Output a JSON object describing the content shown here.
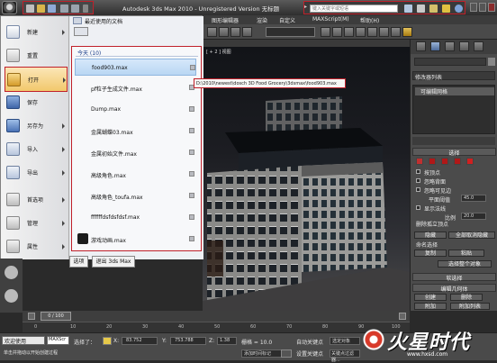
{
  "title_bar": {
    "title": "Autodesk 3ds Max  2010  - Unregistered Version  无标题",
    "search_placeholder": "键入关键字或短语"
  },
  "menubar": {
    "items": [
      "图形编辑器",
      "渲染",
      "自定义",
      "MAXScript(M)",
      "帮助(H)"
    ]
  },
  "viewport": {
    "label": "[ + 2 ] 视图"
  },
  "app_menu": {
    "items": [
      {
        "label": "新建",
        "has_submenu": true,
        "icon": "new-file-icon"
      },
      {
        "label": "重置",
        "has_submenu": false,
        "icon": "reset-icon"
      },
      {
        "label": "打开",
        "has_submenu": true,
        "icon": "open-folder-icon"
      },
      {
        "label": "保存",
        "has_submenu": false,
        "icon": "save-icon"
      },
      {
        "label": "另存为",
        "has_submenu": true,
        "icon": "save-as-icon"
      },
      {
        "label": "导入",
        "has_submenu": true,
        "icon": "import-icon"
      },
      {
        "label": "导出",
        "has_submenu": true,
        "icon": "export-icon"
      },
      {
        "label": "首选项",
        "has_submenu": true,
        "icon": "preferences-icon"
      },
      {
        "label": "管理",
        "has_submenu": true,
        "icon": "manage-icon"
      },
      {
        "label": "属性",
        "has_submenu": true,
        "icon": "properties-icon"
      }
    ],
    "recent_title": "最近使用的文档",
    "recent_group": "今天 (10)",
    "recent_files": [
      "food903.max",
      "pf粒子生成文件.max",
      "Dump.max",
      "金属蝴蝶03.max",
      "金属初始文件.max",
      "高级角色.max",
      "高级角色_toufa.max",
      "ffffffdsfdsfdsf.max",
      "游戏动画.max"
    ],
    "selected_index": 0,
    "options_button": "选项",
    "exit_button": "退出 3ds Max"
  },
  "path_tooltip": "D:\\2010\\newest\\dosch 3D Food Grocery\\3dsmax\\food903.max",
  "command_panel": {
    "modifier_list": "修改器列表",
    "stack_item": "可编辑网格",
    "selection_header": "选择",
    "by_vertex": "按顶点",
    "ignore_backface": "忽略背面",
    "ignore_visible_edges": "忽略可见边",
    "planar_threshold_label": "平面阈值",
    "planar_threshold": "45.0",
    "show_normals": "显示法线",
    "scale_label": "比例",
    "scale_value": "20.0",
    "delete_isolated": "删除孤立顶点",
    "hide_button": "隐藏",
    "unhide_all_button": "全部取消隐藏",
    "named_selection": "命名选择",
    "copy_button": "复制",
    "paste_button": "粘贴",
    "select_whole_object": "选择整个对象",
    "soft_selection": "软选择",
    "edit_geometry": "编辑几何体",
    "create_button": "创建",
    "delete_button": "删除",
    "attach_button": "附加",
    "attach_list_button": "附加列表",
    "detach_button": "断开",
    "extra_button": "..."
  },
  "timeline": {
    "slider_label": "0 / 100",
    "ticks": [
      "0",
      "10",
      "20",
      "30",
      "40",
      "50",
      "60",
      "70",
      "80",
      "90",
      "100"
    ]
  },
  "status_bar": {
    "welcome": "欢迎使用",
    "script_tag": "MAXScr",
    "hint": "单击并拖动以开始创建过程",
    "selected_label": "选择了：",
    "x_label": "X:",
    "x_value": "83.752",
    "y_label": "Y:",
    "y_value": "753.788",
    "z_label": "Z:",
    "z_value": "1.38",
    "grid": "栅格 = 10.0",
    "auto_key": "自动关键点",
    "selected_obj": "选定对象",
    "set_key": "设置关键点",
    "key_filters": "关键点过滤器...",
    "add_time_tag": "添加时间标记"
  },
  "watermark": {
    "text": "火星时代",
    "url": "www.hxsd.com"
  }
}
